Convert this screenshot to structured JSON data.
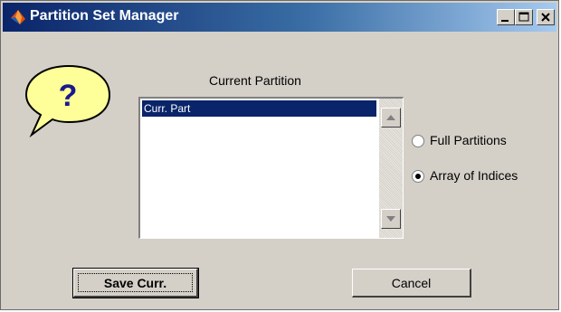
{
  "window": {
    "title": "Partition Set Manager",
    "title_icon": "matlab-icon",
    "controls": [
      "minimize",
      "maximize",
      "close"
    ]
  },
  "help": {
    "label": "?",
    "icon": "speech-bubble-help-icon"
  },
  "partition": {
    "heading": "Current Partition",
    "items": [
      "Curr. Part"
    ],
    "selected_index": 0
  },
  "options": {
    "full_label": "Full Partitions",
    "array_label": "Array of Indices",
    "selected": "Array of Indices"
  },
  "buttons": {
    "save_label": "Save Curr.",
    "cancel_label": "Cancel"
  },
  "colors": {
    "titlebar_start": "#0a246a",
    "titlebar_end": "#a6caf0",
    "selection": "#0a246a",
    "window_bg": "#d4d0c8",
    "help_bubble": "#ffff99"
  }
}
